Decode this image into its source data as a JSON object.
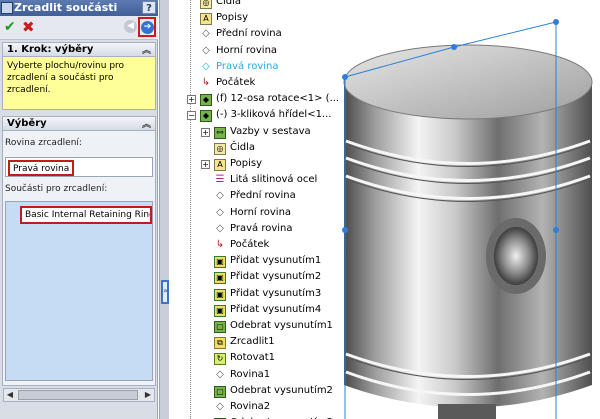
{
  "property_manager": {
    "title": "Zrcadlit součásti",
    "help_label": "?",
    "icons": {
      "ok": "checkmark-icon",
      "cancel": "x-icon",
      "back": "back-arrow-icon",
      "next": "next-arrow-icon",
      "title": "mirror-components-icon"
    },
    "step_section": {
      "header": "1. Krok: výběry",
      "message": "Vyberte plochu/rovinu pro zrcadlení a součásti pro zrcadlení."
    },
    "selections_section": {
      "header": "Výběry",
      "mirror_plane_label": "Rovina zrcadlení:",
      "mirror_plane_value": "Pravá rovina",
      "components_label": "Součásti pro zrcadlení:",
      "components": [
        "Basic Internal Retaining Ring_"
      ]
    },
    "colors": {
      "message_bg": "#ffff99",
      "highlight_border": "#c01c1c",
      "list_bg": "#c5dcf4"
    }
  },
  "feature_tree": {
    "items": [
      {
        "label": "Čidla",
        "icon": "sensor-icon",
        "selected": false
      },
      {
        "label": "Popisy",
        "icon": "annotations-icon",
        "selected": false
      },
      {
        "label": "Přední rovina",
        "icon": "plane-icon",
        "selected": false
      },
      {
        "label": "Horní rovina",
        "icon": "plane-icon",
        "selected": false
      },
      {
        "label": "Pravá rovina",
        "icon": "plane-icon",
        "selected": true
      },
      {
        "label": "Počátek",
        "icon": "origin-icon",
        "selected": false
      },
      {
        "label": "(f) 12-osa rotace<1> (...",
        "icon": "part-icon",
        "selected": false
      },
      {
        "label": "(-) 3-kliková hřídel<1...",
        "icon": "part-icon",
        "selected": false
      },
      {
        "label": "Vazby v sestava",
        "icon": "mates-icon",
        "selected": false
      },
      {
        "label": "Čidla",
        "icon": "sensor-icon",
        "selected": false
      },
      {
        "label": "Popisy",
        "icon": "annotations-icon",
        "selected": false
      },
      {
        "label": "Litá slitinová ocel",
        "icon": "material-icon",
        "selected": false
      },
      {
        "label": "Přední rovina",
        "icon": "plane-icon",
        "selected": false
      },
      {
        "label": "Horní rovina",
        "icon": "plane-icon",
        "selected": false
      },
      {
        "label": "Pravá rovina",
        "icon": "plane-icon",
        "selected": false
      },
      {
        "label": "Počátek",
        "icon": "origin-icon",
        "selected": false
      },
      {
        "label": "Přidat vysunutím1",
        "icon": "extrude-icon",
        "selected": false
      },
      {
        "label": "Přidat vysunutím2",
        "icon": "extrude-icon",
        "selected": false
      },
      {
        "label": "Přidat vysunutím3",
        "icon": "extrude-icon",
        "selected": false
      },
      {
        "label": "Přidat vysunutím4",
        "icon": "extrude-icon",
        "selected": false
      },
      {
        "label": "Odebrat vysunutím1",
        "icon": "cut-extrude-icon",
        "selected": false
      },
      {
        "label": "Zrcadlit1",
        "icon": "mirror-icon",
        "selected": false
      },
      {
        "label": "Rotovat1",
        "icon": "revolve-icon",
        "selected": false
      },
      {
        "label": "Rovina1",
        "icon": "plane-icon",
        "selected": false
      },
      {
        "label": "Odebrat vysunutím2",
        "icon": "cut-extrude-icon",
        "selected": false
      },
      {
        "label": "Rovina2",
        "icon": "plane-icon",
        "selected": false
      },
      {
        "label": "Odebrat vysunutím3",
        "icon": "cut-extrude-icon",
        "selected": false
      }
    ],
    "selected_color": "#2aa6e0"
  },
  "viewport": {
    "model": "piston-3d-model",
    "plane_color": "#2f7fd6"
  }
}
